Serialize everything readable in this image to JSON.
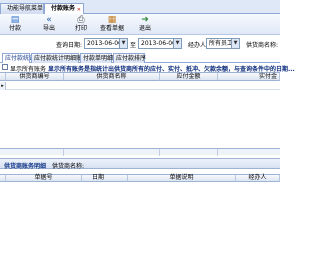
{
  "tabs": {
    "nav_label": "功能导航菜单",
    "active_label": "付款账务"
  },
  "toolbar": {
    "new_label": "付款",
    "export_label": "导出",
    "print_label": "打印",
    "view_label": "查看单据",
    "exit_label": "退出"
  },
  "filter": {
    "date_label": "查询日期:",
    "date_from": "2013-06-06",
    "to_label": "至",
    "date_to": "2013-06-06",
    "handler_label": "经办人:",
    "handler_value": "所有员工",
    "supplier_label": "供货商名称:"
  },
  "inner_tabs": [
    "应付款统计",
    "应付款统计明细账",
    "付款单明细",
    "应付款排序"
  ],
  "check_row": {
    "label": "显示所有账务",
    "note": "显示所有账务是指统计出供货商所有的应付、实付、抵冲、欠款余额，与查询条件中的日期..."
  },
  "grid1": {
    "columns": [
      "供货商编号",
      "供货商名称",
      "应付金额",
      "实付金"
    ]
  },
  "detail": {
    "title": "供货商账务明细",
    "supplier_label": "供货商名称:"
  },
  "grid2": {
    "columns": [
      "单据号",
      "日期",
      "单据说明",
      "经办人"
    ]
  }
}
